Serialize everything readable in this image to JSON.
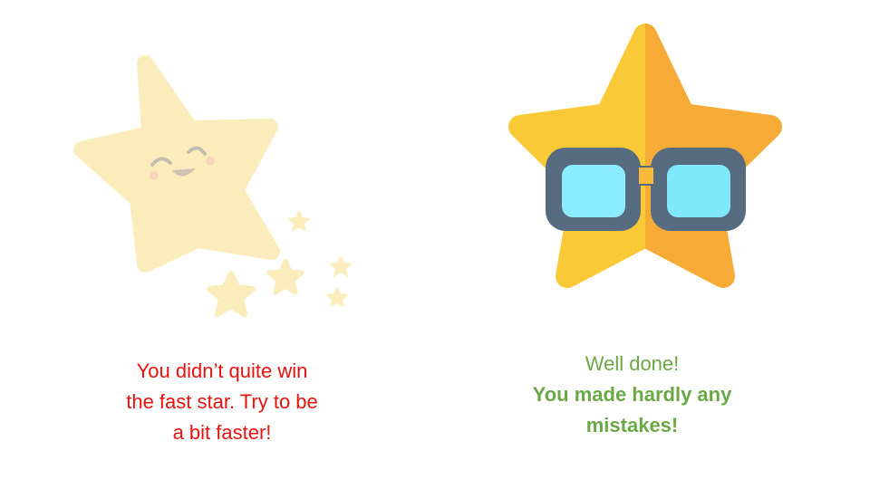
{
  "fail_message": {
    "lines": [
      "You didn’t quite win",
      "the fast star. Try to be",
      "a bit faster!"
    ],
    "color": "#e8120f"
  },
  "success_message": {
    "heading": "Well done!",
    "detail_lines": [
      "You made hardly any",
      "mistakes!"
    ],
    "color": "#6aa845"
  },
  "icons": {
    "fast_star": {
      "name": "smiling-shooting-star-icon",
      "color": "#fbe9a6",
      "state": "faded"
    },
    "cool_star": {
      "name": "star-with-sunglasses-icon",
      "colors": [
        "#f9c938",
        "#f5ab36",
        "#566b80",
        "#8cecff"
      ]
    }
  }
}
